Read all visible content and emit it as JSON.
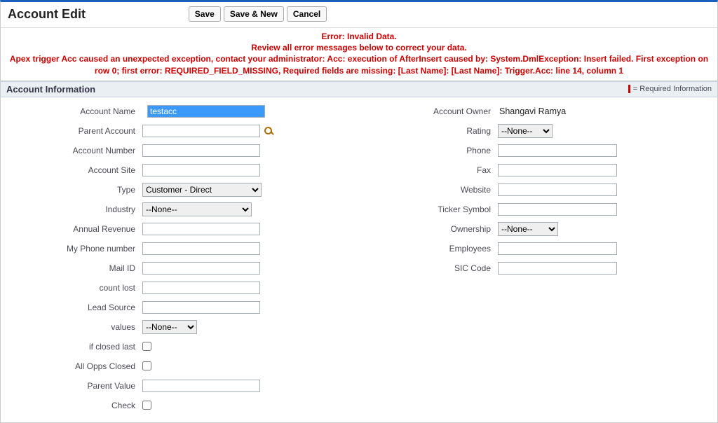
{
  "header": {
    "title": "Account Edit",
    "save_label": "Save",
    "save_new_label": "Save & New",
    "cancel_label": "Cancel"
  },
  "error": {
    "line1": "Error: Invalid Data.",
    "line2": "Review all error messages below to correct your data.",
    "line3": "Apex trigger Acc caused an unexpected exception, contact your administrator: Acc: execution of AfterInsert caused by: System.DmlException: Insert failed. First exception on row 0; first error: REQUIRED_FIELD_MISSING, Required fields are missing: [Last Name]: [Last Name]: Trigger.Acc: line 14, column 1"
  },
  "section": {
    "title": "Account Information",
    "required_legend": "= Required Information"
  },
  "left": {
    "account_name": {
      "label": "Account Name",
      "value": "testacc"
    },
    "parent_account": {
      "label": "Parent Account",
      "value": ""
    },
    "account_number": {
      "label": "Account Number",
      "value": ""
    },
    "account_site": {
      "label": "Account Site",
      "value": ""
    },
    "type": {
      "label": "Type",
      "selected": "Customer - Direct"
    },
    "industry": {
      "label": "Industry",
      "selected": "--None--"
    },
    "annual_revenue": {
      "label": "Annual Revenue",
      "value": ""
    },
    "my_phone": {
      "label": "My Phone number",
      "value": ""
    },
    "mail_id": {
      "label": "Mail ID",
      "value": ""
    },
    "count_lost": {
      "label": "count lost",
      "value": ""
    },
    "lead_source": {
      "label": "Lead Source",
      "value": ""
    },
    "values": {
      "label": "values",
      "selected": "--None--"
    },
    "if_closed_last": {
      "label": "if closed last"
    },
    "all_opps_closed": {
      "label": "All Opps Closed"
    },
    "parent_value": {
      "label": "Parent Value",
      "value": ""
    },
    "check": {
      "label": "Check"
    }
  },
  "right": {
    "account_owner": {
      "label": "Account Owner",
      "value": "Shangavi Ramya"
    },
    "rating": {
      "label": "Rating",
      "selected": "--None--"
    },
    "phone": {
      "label": "Phone",
      "value": ""
    },
    "fax": {
      "label": "Fax",
      "value": ""
    },
    "website": {
      "label": "Website",
      "value": ""
    },
    "ticker_symbol": {
      "label": "Ticker Symbol",
      "value": ""
    },
    "ownership": {
      "label": "Ownership",
      "selected": "--None--"
    },
    "employees": {
      "label": "Employees",
      "value": ""
    },
    "sic_code": {
      "label": "SIC Code",
      "value": ""
    }
  }
}
